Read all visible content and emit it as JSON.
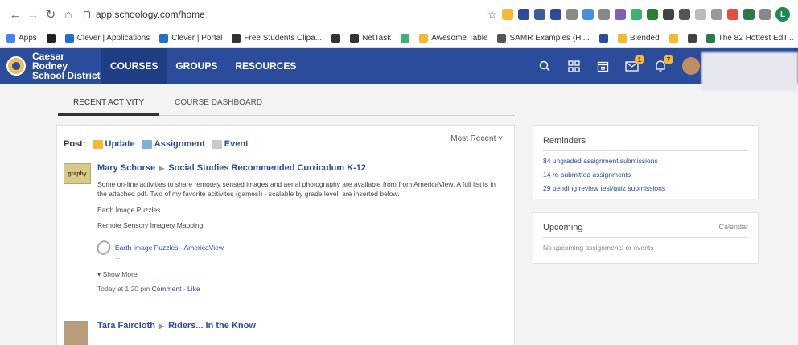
{
  "browser": {
    "url": "app.schoology.com/home",
    "profile_initial": "L",
    "extension_colors": [
      "#f5b82e",
      "#2b4c9b",
      "#3c5a9a",
      "#2b4c9b",
      "#888888",
      "#4a90d9",
      "#888888",
      "#7b61b8",
      "#3cb371",
      "#2e7d32",
      "#444444",
      "#555555",
      "#bbbbbb",
      "#999999",
      "#e74c3c",
      "#2b7a4b",
      "#888888"
    ]
  },
  "bookmarks": [
    {
      "label": "Apps",
      "color": "#4285f4"
    },
    {
      "label": "",
      "color": "#222222"
    },
    {
      "label": "Clever | Applications",
      "color": "#1f6fd1"
    },
    {
      "label": "Clever | Portal",
      "color": "#1f6fd1"
    },
    {
      "label": "Free Students Clipa...",
      "color": "#333333"
    },
    {
      "label": "",
      "color": "#333333"
    },
    {
      "label": "NetTask",
      "color": "#333333"
    },
    {
      "label": "",
      "color": "#3cb371"
    },
    {
      "label": "Awesome Table",
      "color": "#f5b82e"
    },
    {
      "label": "SAMR Examples (Hi...",
      "color": "#555555"
    },
    {
      "label": "",
      "color": "#2b4c9b"
    },
    {
      "label": "Blended",
      "color": "#f5b82e"
    },
    {
      "label": "",
      "color": "#f5b82e"
    },
    {
      "label": "",
      "color": "#444444"
    },
    {
      "label": "The 82 Hottest EdT...",
      "color": "#2b7a4b"
    }
  ],
  "nav": {
    "district_name": "Caesar Rodney School District",
    "links": [
      "COURSES",
      "GROUPS",
      "RESOURCES"
    ],
    "active_link": "COURSES",
    "message_badge": "1",
    "notification_badge": "7"
  },
  "tabs": [
    "RECENT ACTIVITY",
    "COURSE DASHBOARD"
  ],
  "feed": {
    "post_label": "Post:",
    "post_options": [
      {
        "label": "Update",
        "color": "#f5b82e"
      },
      {
        "label": "Assignment",
        "color": "#7fb0d9"
      },
      {
        "label": "Event",
        "color": "#c9c9c9"
      }
    ],
    "sort_label": "Most Recent",
    "items": [
      {
        "thumb_text": "graphy",
        "author": "Mary Schorse",
        "target": "Social Studies Recommended Curriculum K-12",
        "text": "Some on-line activities to share remotely sensed images and aerial photography are available from from AmericaView. A full list is in the attached pdf. Two of my favorite acitivites (games!) - scalable by grade level, are inserted below.",
        "lines": [
          "Earth Image Puzzles",
          "Remote Sensory Imagery Mapping"
        ],
        "attachment": "Earth Image Puzzles - AmericaView",
        "attachment_sub": "...",
        "show_more": "Show More",
        "time": "Today at 1:20 pm",
        "comment": "Comment",
        "like": "Like"
      },
      {
        "author": "Tara Faircloth",
        "target": "Riders... In the Know"
      }
    ]
  },
  "reminders": {
    "title": "Reminders",
    "items": [
      "84 ungraded assignment submissions",
      "14 re-submitted assignments",
      "29 pending review test/quiz submissions"
    ]
  },
  "upcoming": {
    "title": "Upcoming",
    "calendar_link": "Calendar",
    "empty_text": "No upcoming assignments or events"
  }
}
